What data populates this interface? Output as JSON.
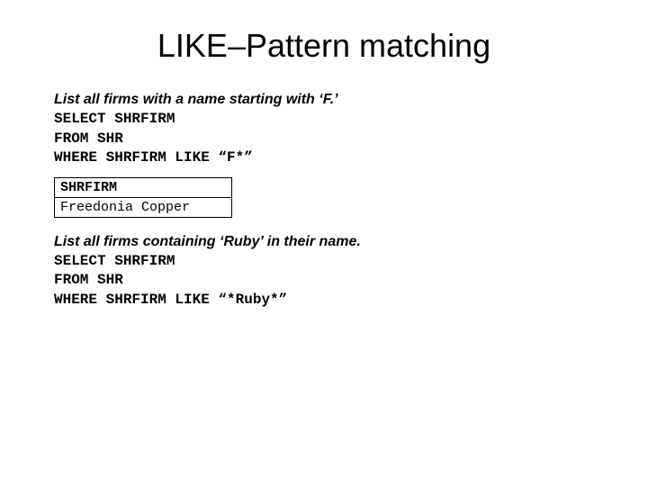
{
  "title": "LIKE–Pattern matching",
  "section1": {
    "prompt": "List all firms with a name starting with ‘F.’",
    "sql_line1": "SELECT SHRFIRM",
    "sql_line2": "FROM SHR",
    "sql_line3": "WHERE SHRFIRM LIKE “F*”"
  },
  "table": {
    "header": "SHRFIRM",
    "row1": "Freedonia Copper"
  },
  "section2": {
    "prompt": "List all firms containing ‘Ruby’ in their name.",
    "sql_line1": "SELECT SHRFIRM",
    "sql_line2": "FROM SHR",
    "sql_line3": "WHERE SHRFIRM LIKE “*Ruby*”"
  }
}
